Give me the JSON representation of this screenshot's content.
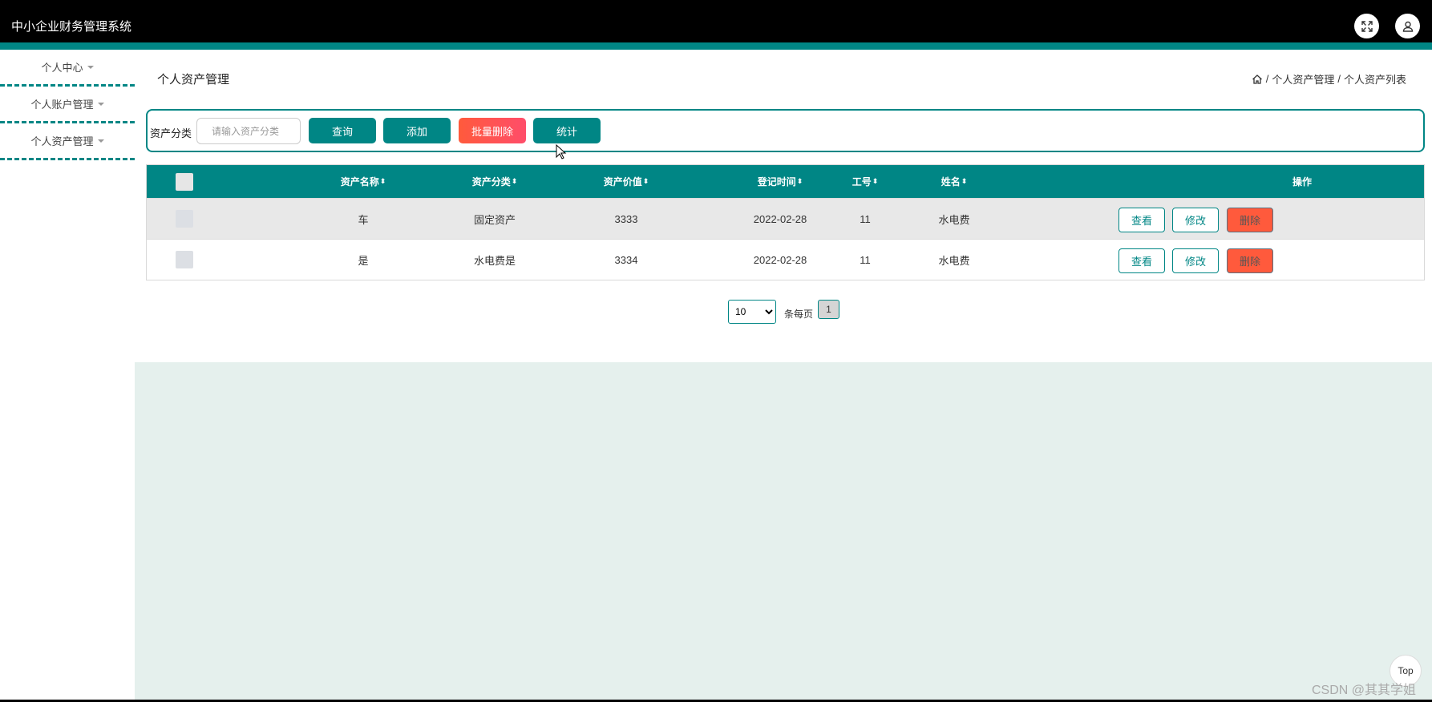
{
  "app": {
    "title": "中小企业财务管理系统",
    "accent_color": "#008685",
    "icons": {
      "fullscreen": "fullscreen-icon",
      "user": "user-icon"
    }
  },
  "sidebar": {
    "items": [
      {
        "label": "个人中心"
      },
      {
        "label": "个人账户管理"
      },
      {
        "label": "个人资产管理"
      }
    ]
  },
  "page": {
    "title": "个人资产管理",
    "breadcrumb": [
      "个人资产管理",
      "个人资产列表"
    ],
    "breadcrumb_sep": "/"
  },
  "search": {
    "label": "资产分类",
    "placeholder": "请输入资产分类",
    "value": "",
    "buttons": {
      "query": "查询",
      "add": "添加",
      "batch_delete": "批量删除",
      "stats": "统计"
    }
  },
  "table": {
    "columns": [
      "资产名称",
      "资产分类",
      "资产价值",
      "登记时间",
      "工号",
      "姓名",
      "操作"
    ],
    "sort_icon": "⬍",
    "rows": [
      {
        "name": "车",
        "category": "固定资产",
        "value": "3333",
        "date": "2022-02-28",
        "emp_no": "11",
        "person": "水电费"
      },
      {
        "name": "是",
        "category": "水电费是",
        "value": "3334",
        "date": "2022-02-28",
        "emp_no": "11",
        "person": "水电费"
      }
    ],
    "actions": {
      "view": "查看",
      "edit": "修改",
      "delete": "删除"
    }
  },
  "pagination": {
    "page_size": "10",
    "page_size_options": [
      "10"
    ],
    "per_page_label": "条每页",
    "current_page": "1"
  },
  "footer": {
    "top_label": "Top",
    "watermark": "CSDN @其其学姐"
  }
}
